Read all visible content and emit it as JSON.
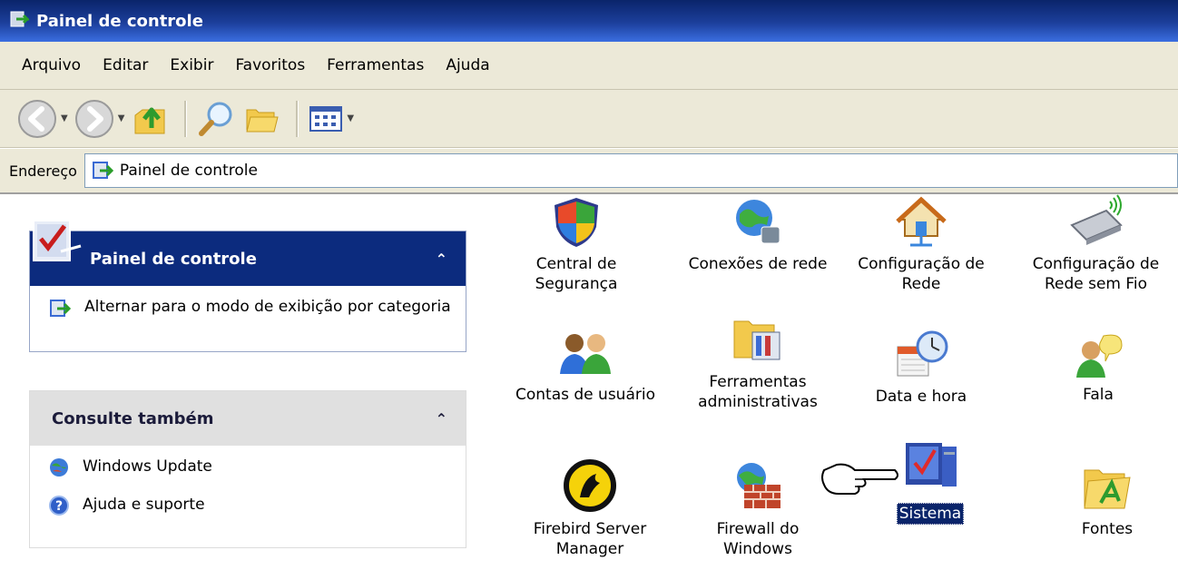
{
  "window": {
    "title": "Painel de controle"
  },
  "menu": [
    "Arquivo",
    "Editar",
    "Exibir",
    "Favoritos",
    "Ferramentas",
    "Ajuda"
  ],
  "address": {
    "label": "Endereço",
    "value": "Painel de controle"
  },
  "task_pane": {
    "main": {
      "title": "Painel de controle",
      "link": "Alternar para o modo de exibição por categoria"
    },
    "see_also": {
      "title": "Consulte também",
      "links": [
        "Windows Update",
        "Ajuda e suporte"
      ]
    }
  },
  "items": [
    {
      "label": "Central de Segurança",
      "icon": "security-shield-icon"
    },
    {
      "label": "Conexões de rede",
      "icon": "network-globe-icon"
    },
    {
      "label": "Configuração de Rede",
      "icon": "home-network-icon"
    },
    {
      "label": "Configuração de Rede sem Fio",
      "icon": "wireless-icon"
    },
    {
      "label": "Contas de usuário",
      "icon": "users-icon"
    },
    {
      "label": "Ferramentas administrativas",
      "icon": "admin-tools-icon"
    },
    {
      "label": "Data e hora",
      "icon": "calendar-clock-icon"
    },
    {
      "label": "Fala",
      "icon": "speech-icon"
    },
    {
      "label": "Firebird Server Manager",
      "icon": "firebird-icon"
    },
    {
      "label": "Firewall do Windows",
      "icon": "firewall-icon"
    },
    {
      "label": "Sistema",
      "icon": "computer-system-icon",
      "selected": true
    },
    {
      "label": "Fontes",
      "icon": "fonts-folder-icon"
    }
  ],
  "colors": {
    "titlebar": "#0a246a",
    "panel_header": "#0c2b7e",
    "chrome": "#ece9d8",
    "selection": "#0a246a"
  }
}
